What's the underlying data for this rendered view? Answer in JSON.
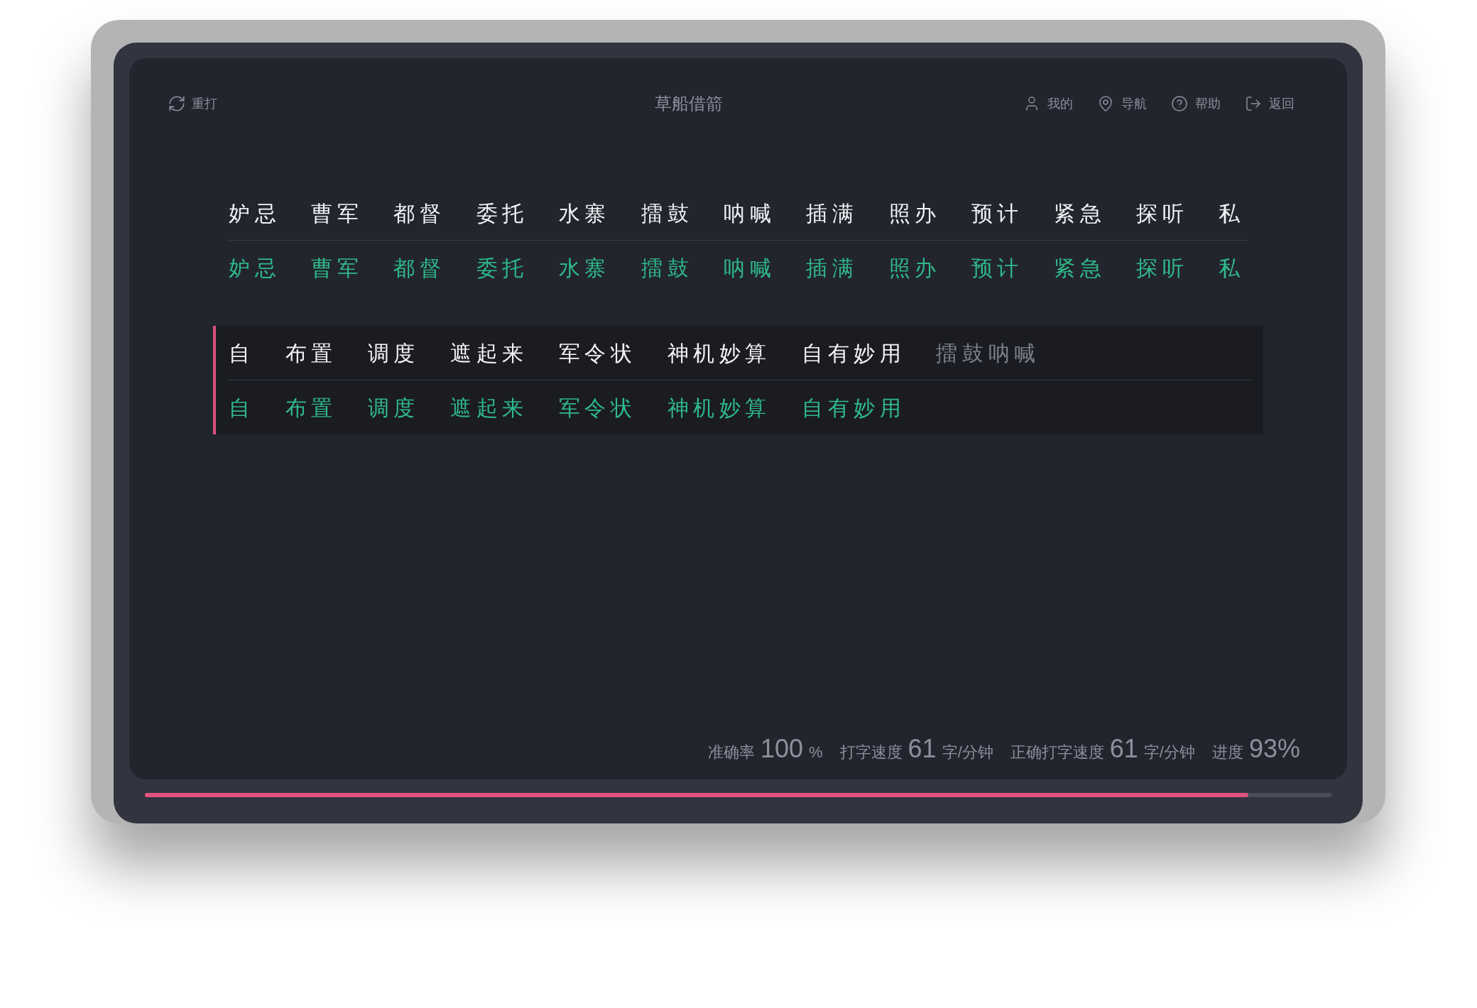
{
  "toolbar": {
    "restart": "重打",
    "title": "草船借箭",
    "menu": [
      {
        "kind": "user",
        "label": "我的"
      },
      {
        "kind": "pin",
        "label": "导航"
      },
      {
        "kind": "help",
        "label": "帮助"
      },
      {
        "kind": "exit",
        "label": "返回"
      }
    ]
  },
  "lines": [
    {
      "active": false,
      "words": [
        {
          "text": "妒忌",
          "done": true
        },
        {
          "text": "曹军",
          "done": true
        },
        {
          "text": "都督",
          "done": true
        },
        {
          "text": "委托",
          "done": true
        },
        {
          "text": "水寨",
          "done": true
        },
        {
          "text": "擂鼓",
          "done": true
        },
        {
          "text": "呐喊",
          "done": true
        },
        {
          "text": "插满",
          "done": true
        },
        {
          "text": "照办",
          "done": true
        },
        {
          "text": "预计",
          "done": true
        },
        {
          "text": "紧急",
          "done": true
        },
        {
          "text": "探听",
          "done": true
        },
        {
          "text": "私",
          "done": true
        }
      ],
      "input": [
        "妒忌",
        "曹军",
        "都督",
        "委托",
        "水寨",
        "擂鼓",
        "呐喊",
        "插满",
        "照办",
        "预计",
        "紧急",
        "探听",
        "私"
      ]
    },
    {
      "active": true,
      "words": [
        {
          "text": "自",
          "done": true
        },
        {
          "text": "布置",
          "done": true
        },
        {
          "text": "调度",
          "done": true
        },
        {
          "text": "遮起来",
          "done": true
        },
        {
          "text": "军令状",
          "done": true
        },
        {
          "text": "神机妙算",
          "done": true
        },
        {
          "text": "自有妙用",
          "done": true
        },
        {
          "text": "擂鼓呐喊",
          "done": false
        }
      ],
      "input": [
        "自",
        "布置",
        "调度",
        "遮起来",
        "军令状",
        "神机妙算",
        "自有妙用"
      ]
    }
  ],
  "stats": [
    {
      "label": "准确率",
      "value": "100",
      "unit": "%"
    },
    {
      "label": "打字速度",
      "value": "61",
      "unit": "字/分钟"
    },
    {
      "label": "正确打字速度",
      "value": "61",
      "unit": "字/分钟"
    },
    {
      "label": "进度",
      "value": "93%"
    }
  ],
  "progress": {
    "level": 0.93
  }
}
